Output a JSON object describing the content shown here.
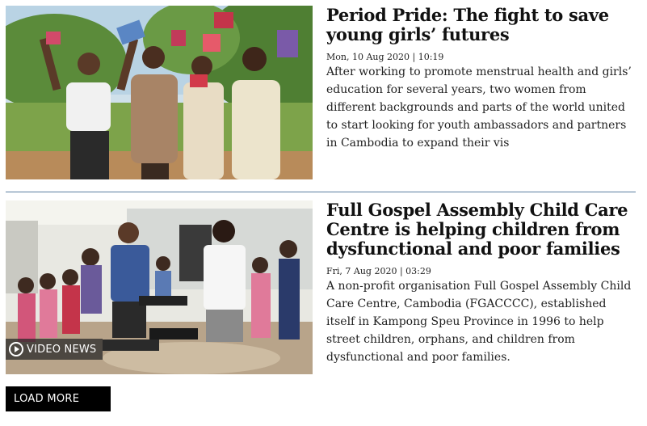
{
  "articles": [
    {
      "headline": "Period Pride: The fight to save young girls’ futures",
      "date": "Mon, 10 Aug 2020 | 10:19",
      "summary": "After working to promote menstrual health and girls’ education for several years, two women from different backgrounds and parts of the world united to start looking for youth ambassadors and partners in Cambodia to expand their vis"
    },
    {
      "headline": "Full Gospel Assembly Child Care Centre is helping children from dysfunctional and poor families",
      "date": "Fri, 7 Aug 2020 | 03:29",
      "summary": "A non-profit organisation Full Gospel Assembly Child Care Centre, Cambodia (FGACCCC), established itself in Kampong Speu Province in 1996 to help street children, orphans, and children from dysfunctional and poor families.",
      "badge": "VIDEO NEWS"
    }
  ],
  "load_more_label": "LOAD MORE"
}
